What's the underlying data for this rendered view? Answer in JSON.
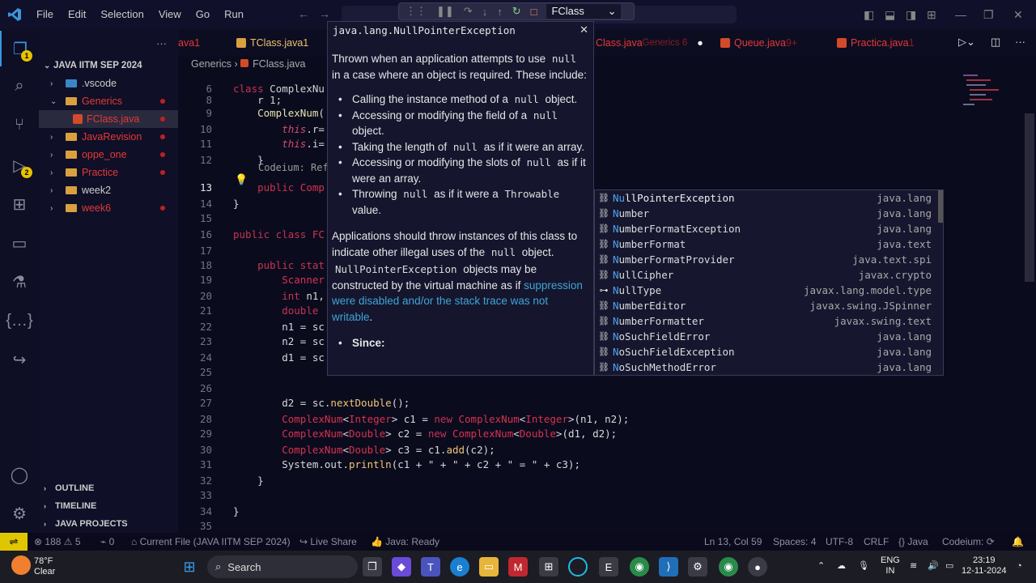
{
  "menu": [
    "File",
    "Edit",
    "Selection",
    "View",
    "Go",
    "Run"
  ],
  "debug": {
    "config": "FClass"
  },
  "sidebar": {
    "title": "JAVA IITM SEP 2024",
    "items": [
      {
        "label": ".vscode",
        "kind": "folder-vscode",
        "indent": 1,
        "chev": "›",
        "color": "#cccccc"
      },
      {
        "label": "Generics",
        "kind": "folder",
        "indent": 1,
        "chev": "⌄",
        "color": "#e53935",
        "dot": true
      },
      {
        "label": "FClass.java",
        "kind": "java",
        "indent": 2,
        "chev": "",
        "color": "#e53935",
        "dot": true,
        "selected": true
      },
      {
        "label": "JavaRevision",
        "kind": "folder",
        "indent": 1,
        "chev": "›",
        "color": "#e53935",
        "dot": true
      },
      {
        "label": "oppe_one",
        "kind": "folder",
        "indent": 1,
        "chev": "›",
        "color": "#e53935",
        "dot": true
      },
      {
        "label": "Practice",
        "kind": "folder",
        "indent": 1,
        "chev": "›",
        "color": "#e53935",
        "dot": true
      },
      {
        "label": "week2",
        "kind": "folder",
        "indent": 1,
        "chev": "›",
        "color": "#cccccc"
      },
      {
        "label": "week6",
        "kind": "folder",
        "indent": 1,
        "chev": "›",
        "color": "#e53935",
        "dot": true
      }
    ],
    "sections": [
      "OUTLINE",
      "TIMELINE",
      "JAVA PROJECTS"
    ]
  },
  "tabs": [
    {
      "label": "ava",
      "suffix": " 1",
      "color": "#e53935"
    },
    {
      "label": "TClass.java",
      "suffix": " 1",
      "color": "#e8c46a"
    },
    {
      "label": "Class.java",
      "suffix": " Generics 6",
      "color": "#e53935"
    },
    {
      "label": "Queue.java",
      "suffix": " 9+",
      "color": "#e53935"
    },
    {
      "label": "Practica.java",
      "suffix": " 1",
      "color": "#e53935"
    }
  ],
  "breadcrumb": [
    "Generics",
    "FClass.java"
  ],
  "code_lines": [
    {
      "n": "6",
      "html": "<span class='kw'>class</span> <span class='vr'>ComplexNu</span>"
    },
    {
      "n": "8",
      "html": "    <span class='vr'>r 1;</span>"
    },
    {
      "n": "9",
      "html": "    <span class='fn2'>ComplexNum</span>("
    },
    {
      "n": "10",
      "html": "        <span class='th'>this</span>.r="
    },
    {
      "n": "11",
      "html": "        <span class='th'>this</span>.i="
    },
    {
      "n": "12",
      "html": "    }"
    },
    {
      "n": "13",
      "html": "    <span class='kw'>public</span> <span class='ty'>Comp</span>"
    },
    {
      "n": "14",
      "html": "}"
    },
    {
      "n": "15",
      "html": ""
    },
    {
      "n": "16",
      "html": "<span class='kw'>public class</span> <span class='ty'>FC</span>"
    },
    {
      "n": "17",
      "html": ""
    },
    {
      "n": "18",
      "html": "    <span class='kw'>public</span> <span class='kw'>stat</span>"
    },
    {
      "n": "19",
      "html": "        <span class='ty'>Scanner</span>"
    },
    {
      "n": "20",
      "html": "        <span class='kw'>int</span> n1,"
    },
    {
      "n": "21",
      "html": "        <span class='kw'>double</span>"
    },
    {
      "n": "22",
      "html": "        n1 = sc"
    },
    {
      "n": "23",
      "html": "        n2 = sc"
    },
    {
      "n": "24",
      "html": "        d1 = sc"
    },
    {
      "n": "25",
      "html": ""
    },
    {
      "n": "26",
      "html": ""
    },
    {
      "n": "27",
      "html": "        d2 = sc.<span class='fn'>nextDouble</span>();"
    },
    {
      "n": "28",
      "html": "        <span class='ty'>ComplexNum</span>&lt;<span class='ty'>Integer</span>&gt; c1 = <span class='kw'>new</span> <span class='ty'>ComplexNum</span>&lt;<span class='ty'>Integer</span>&gt;(n1, n2);"
    },
    {
      "n": "29",
      "html": "        <span class='ty'>ComplexNum</span>&lt;<span class='ty'>Double</span>&gt; c2 = <span class='kw'>new</span> <span class='ty'>ComplexNum</span>&lt;<span class='ty'>Double</span>&gt;(d1, d2);"
    },
    {
      "n": "30",
      "html": "        <span class='ty'>ComplexNum</span>&lt;<span class='ty'>Double</span>&gt; c3 = c1.<span class='fn'>add</span>(c2);"
    },
    {
      "n": "31",
      "html": "        System.out.<span class='fn'>println</span>(c1 + \" + \" + c2 + \" = \" + c3);"
    },
    {
      "n": "32",
      "html": "    }"
    },
    {
      "n": "33",
      "html": ""
    },
    {
      "n": "34",
      "html": "}"
    },
    {
      "n": "35",
      "html": ""
    }
  ],
  "codeium_hint": "Codeium: Refact",
  "hover": {
    "title": "java.lang.NullPointerException",
    "p1a": "Thrown when an application attempts to use",
    "p1code": "null",
    "p1b": "in a case where an object is required. These include:",
    "list": [
      {
        "a": "Calling the instance method of a",
        "code": "null",
        "b": "object."
      },
      {
        "a": "Accessing or modifying the field of a",
        "code": "null",
        "b": "object."
      },
      {
        "a": "Taking the length of",
        "code": "null",
        "b": "as if it were an array."
      },
      {
        "a": "Accessing or modifying the slots of",
        "code": "null",
        "b": "as if it were an array."
      },
      {
        "a": "Throwing",
        "code": "null",
        "b": "as if it were a",
        "code2": "Throwable",
        "c": "value."
      }
    ],
    "p2a": "Applications should throw instances of this class to indicate other illegal uses of the",
    "p2code": "null",
    "p2b": "object.",
    "p3code": "NullPointerException",
    "p3a": "objects may be constructed by the virtual machine as if",
    "p3link": "suppression were disabled and/or the stack trace was not writable",
    "p3b": ".",
    "since": "Since:"
  },
  "suggestions": [
    {
      "pre": "Nu",
      "rest": "llPointerException",
      "pkg": "java.lang",
      "icon": "class"
    },
    {
      "pre": "N",
      "rest": "umber",
      "pkg": "java.lang",
      "icon": "class"
    },
    {
      "pre": "N",
      "rest": "umberFormatException",
      "pkg": "java.lang",
      "icon": "class"
    },
    {
      "pre": "N",
      "rest": "umberFormat",
      "pkg": "java.text",
      "icon": "class"
    },
    {
      "pre": "N",
      "rest": "umberFormatProvider",
      "pkg": "java.text.spi",
      "icon": "class"
    },
    {
      "pre": "N",
      "rest": "ullCipher",
      "pkg": "javax.crypto",
      "icon": "class"
    },
    {
      "pre": "N",
      "rest": "ullType",
      "pkg": "javax.lang.model.type",
      "icon": "interface"
    },
    {
      "pre": "N",
      "rest": "umberEditor",
      "pkg": "javax.swing.JSpinner",
      "icon": "class"
    },
    {
      "pre": "N",
      "rest": "umberFormatter",
      "pkg": "javax.swing.text",
      "icon": "class"
    },
    {
      "pre": "N",
      "rest": "oSuchFieldError",
      "pkg": "java.lang",
      "icon": "class"
    },
    {
      "pre": "N",
      "rest": "oSuchFieldException",
      "pkg": "java.lang",
      "icon": "class"
    },
    {
      "pre": "N",
      "rest": "oSuchMethodError",
      "pkg": "java.lang",
      "icon": "class"
    }
  ],
  "status": {
    "errors": "188",
    "warnings": "5",
    "info": "0",
    "current_file": "Current File (JAVA IITM SEP 2024)",
    "live_share": "Live Share",
    "java_ready": "Java: Ready",
    "position": "Ln 13, Col 59",
    "spaces": "Spaces: 4",
    "encoding": "UTF-8",
    "eol": "CRLF",
    "language": "Java",
    "codeium": "Codeium:"
  },
  "taskbar": {
    "weather_temp": "78°F",
    "weather_desc": "Clear",
    "search": "Search",
    "lang1": "ENG",
    "lang2": "IN",
    "time": "23:19",
    "date": "12-11-2024"
  },
  "colors": {
    "accent": "#3a96dd",
    "error": "#e53935",
    "remote": "#e0c600"
  }
}
